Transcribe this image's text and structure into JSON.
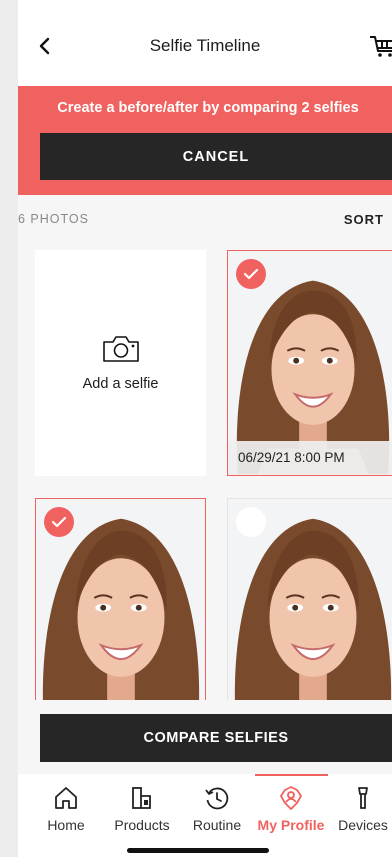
{
  "header": {
    "title": "Selfie Timeline"
  },
  "banner": {
    "message": "Create a before/after by comparing 2 selfies",
    "cancel_label": "CANCEL"
  },
  "gallery": {
    "count_label": "6 PHOTOS",
    "sort_label": "SORT",
    "add_label": "Add a selfie",
    "photos": [
      {
        "date": "06/29/21 8:00 PM",
        "selected": true
      },
      {
        "date": "",
        "selected": true
      },
      {
        "date": "",
        "selected": false
      }
    ]
  },
  "compare_label": "COMPARE SELFIES",
  "nav": {
    "items": [
      {
        "label": "Home",
        "icon": "home-icon"
      },
      {
        "label": "Products",
        "icon": "products-icon"
      },
      {
        "label": "Routine",
        "icon": "routine-icon"
      },
      {
        "label": "My Profile",
        "icon": "profile-icon",
        "active": true
      },
      {
        "label": "Devices",
        "icon": "devices-icon"
      }
    ]
  },
  "colors": {
    "accent": "#f0625f",
    "dark_button": "#262626"
  }
}
